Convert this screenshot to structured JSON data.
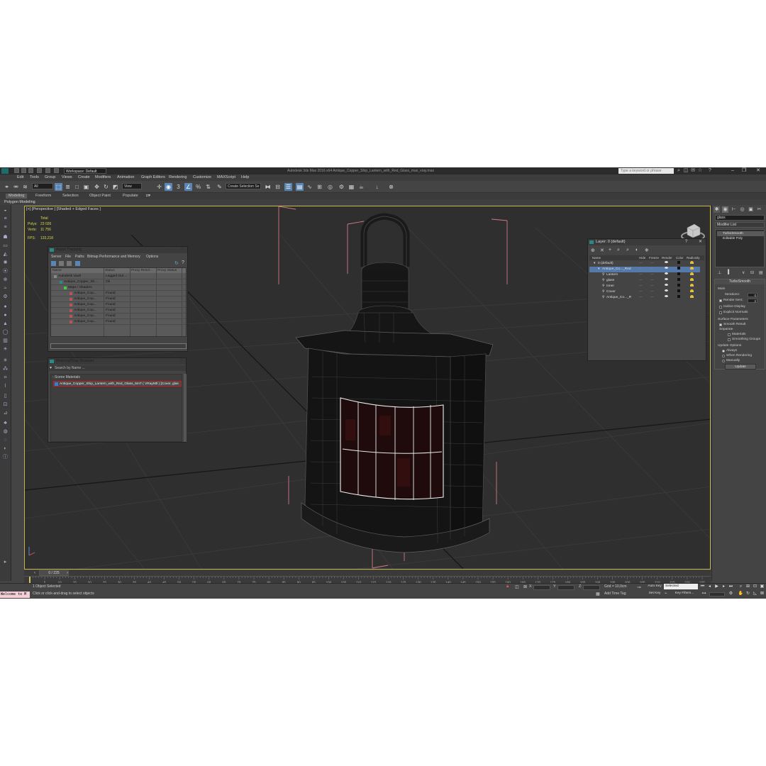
{
  "titlebar": {
    "workspace": "Workspace: Default",
    "title": "Autodesk 3ds Max  2016 x64    Antique_Copper_Ship_Lantern_with_Red_Glass_max_vray.max",
    "search_placeholder": "Type a keyword or phrase"
  },
  "menu": [
    "Edit",
    "Tools",
    "Group",
    "Views",
    "Create",
    "Modifiers",
    "Animation",
    "Graph Editors",
    "Rendering",
    "Customize",
    "MAXScript",
    "Help"
  ],
  "toolbar": {
    "filter_select": "All",
    "ref_coord": "View",
    "selection_set": "Create Selection Se"
  },
  "ribbon": {
    "tabs": [
      "Modeling",
      "Freeform",
      "Selection",
      "Object Paint",
      "Populate"
    ],
    "sub": "Polygon Modeling"
  },
  "viewport": {
    "label": "[+] [Perspective ] [Shaded + Edged Faces ]",
    "stats": {
      "total": "Total",
      "polys_k": "Polys:",
      "polys": "23 026",
      "verts_k": "Verts:",
      "verts": "11 756",
      "fps_k": "FPS:",
      "fps": "133,218"
    }
  },
  "asset_tracking": {
    "title": "Asset Tracking",
    "menu": [
      "Server",
      "File",
      "Paths",
      "Bitmap Performance and Memory",
      "Options"
    ],
    "columns": [
      "Name",
      "Status",
      "Proxy Resol...",
      "Proxy Status"
    ],
    "rows": [
      {
        "name": "Autodesk Vault",
        "status": "Logged Out ..."
      },
      {
        "name": "Antique_Copper_Sh...",
        "status": "Ok"
      },
      {
        "name": "Maps / Shaders",
        "status": ""
      },
      {
        "name": "Antique_Cop...",
        "status": "Found"
      },
      {
        "name": "Antique_Cop...",
        "status": "Found"
      },
      {
        "name": "Antique_Cop...",
        "status": "Found"
      },
      {
        "name": "Antique_Cop...",
        "status": "Found"
      },
      {
        "name": "Antique_Cop...",
        "status": "Found"
      },
      {
        "name": "Antique_Cop...",
        "status": "Found"
      }
    ]
  },
  "material_browser": {
    "title": "Material/Map Browser",
    "search": "Search by Name ...",
    "group": "- Scene Materials",
    "item": "Antique_Copper_Ship_Lantern_with_Red_Glass_MAT ( VRayMtl ) [Cover, glas"
  },
  "layer_window": {
    "title": "Layer: 0 (default)",
    "columns": [
      "Name",
      "Hide",
      "Freeze",
      "Render",
      "Color",
      "Radiosity"
    ],
    "rows": [
      {
        "name": "0 (default)",
        "indent": 0
      },
      {
        "name": "Antique_Co..._Red",
        "indent": 1
      },
      {
        "name": "Lantern",
        "indent": 2
      },
      {
        "name": "glass",
        "indent": 2
      },
      {
        "name": "Inner",
        "indent": 2
      },
      {
        "name": "Cover",
        "indent": 2
      },
      {
        "name": "Antique_Co..._R",
        "indent": 2
      }
    ]
  },
  "command_panel": {
    "object_name": "glass",
    "modifier_list": "Modifier List",
    "stack": [
      "TurboSmooth",
      "Editable Poly"
    ],
    "turbosmooth": {
      "title": "TurboSmooth",
      "main": "Main",
      "iterations_label": "Iterations:",
      "iterations": "0",
      "render_iters_label": "Render Iters:",
      "render_iters": "2",
      "isoline": "Isoline Display",
      "explicit": "Explicit Normals",
      "surface": "Surface Parameters",
      "smooth_result": "Smooth Result",
      "separate": "Separate",
      "materials": "Materials",
      "smoothing_groups": "Smoothing Groups",
      "update_options": "Update Options",
      "always": "Always",
      "when_rendering": "When Rendering",
      "manually": "Manually",
      "update_btn": "Update"
    }
  },
  "timeline": {
    "slider": "0 / 225",
    "ticks": [
      "0",
      "5",
      "10",
      "15",
      "20",
      "25",
      "30",
      "35",
      "40",
      "45",
      "50",
      "55",
      "60",
      "65",
      "70",
      "75",
      "80",
      "85",
      "90",
      "95",
      "100",
      "105",
      "110",
      "115",
      "120",
      "125",
      "130",
      "135",
      "140",
      "145",
      "150",
      "155",
      "160",
      "165",
      "170",
      "175",
      "180",
      "185",
      "190",
      "195",
      "200",
      "205",
      "210",
      "215",
      "220",
      "225"
    ]
  },
  "status": {
    "maxscript": "Welcome to M",
    "selected": "1 Object Selected",
    "prompt": "Click or click-and-drag to select objects",
    "x_label": "X:",
    "y_label": "Y:",
    "z_label": "Z:",
    "grid": "Grid = 10,0cm",
    "add_time_tag": "Add Time Tag",
    "auto_key": "Auto Key",
    "set_key": "Set Key",
    "selected_mode": "Selected",
    "key_filters": "Key Filters..."
  }
}
